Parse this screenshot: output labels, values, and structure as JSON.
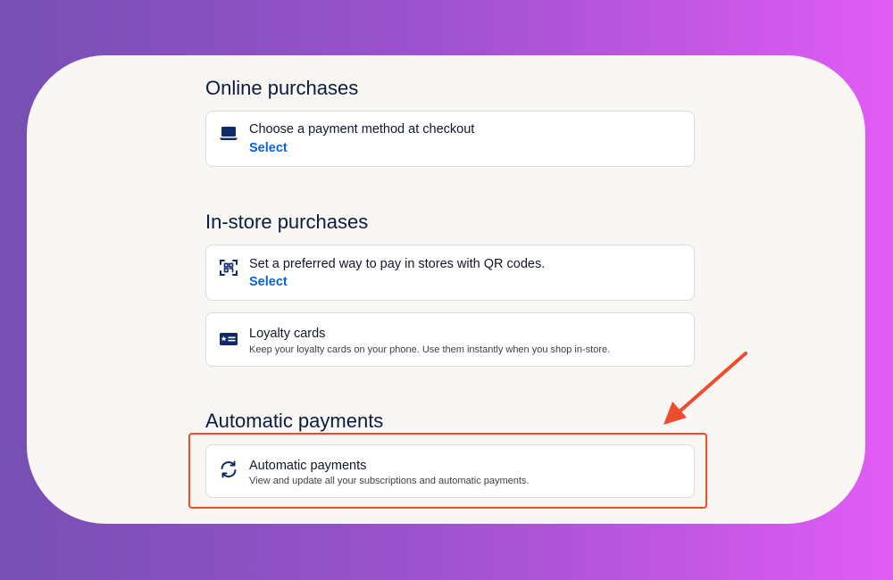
{
  "sections": {
    "online": {
      "heading": "Online purchases",
      "checkout": {
        "title": "Choose a payment method at checkout",
        "action": "Select",
        "icon": "laptop-icon"
      }
    },
    "instore": {
      "heading": "In-store purchases",
      "qr": {
        "title": "Set a preferred way to pay in stores with QR codes.",
        "action": "Select",
        "icon": "qr-scan-icon"
      },
      "loyalty": {
        "title": "Loyalty cards",
        "subtitle": "Keep your loyalty cards on your phone. Use them instantly when you shop in-store.",
        "icon": "id-card-icon"
      }
    },
    "automatic": {
      "heading": "Automatic payments",
      "autopay": {
        "title": "Automatic payments",
        "subtitle": "View and update all your subscriptions and automatic payments.",
        "icon": "refresh-icon"
      }
    }
  },
  "colors": {
    "background_start": "#7650b3",
    "background_end": "#e15cf6",
    "card": "#f8f7f4",
    "heading": "#0d1b3d",
    "link": "#0a63d6",
    "icon": "#0e2a6b",
    "highlight": "#ee4c2c"
  }
}
